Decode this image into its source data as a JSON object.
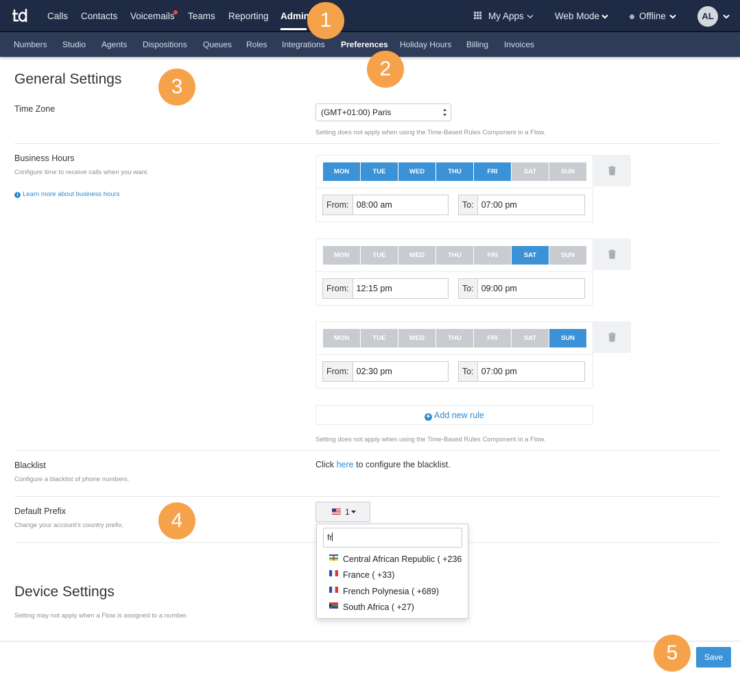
{
  "topnav": {
    "logo": "td",
    "items": [
      "Calls",
      "Contacts",
      "Voicemails",
      "Teams",
      "Reporting",
      "Admin"
    ],
    "my_apps": "My Apps",
    "web_mode": "Web Mode",
    "status": "Offline",
    "avatar": "AL"
  },
  "subnav": {
    "items": [
      "Numbers",
      "Studio",
      "Agents",
      "Dispositions",
      "Queues",
      "Roles",
      "Integrations",
      "Preferences",
      "Holiday Hours",
      "Billing",
      "Invoices"
    ]
  },
  "badges": [
    "1",
    "2",
    "3",
    "4",
    "5"
  ],
  "general": {
    "title": "General Settings",
    "timezone_label": "Time Zone",
    "timezone_value": "(GMT+01:00) Paris",
    "timezone_hint": "Setting does not apply when using the Time-Based Rules Component in a Flow.",
    "bh_label": "Business Hours",
    "bh_sub": "Configure time to receive calls when you want.",
    "bh_link": "Learn more about business hours",
    "days": [
      "MON",
      "TUE",
      "WED",
      "THU",
      "FRI",
      "SAT",
      "SUN"
    ],
    "from_label": "From:",
    "to_label": "To:",
    "rules": [
      {
        "from": "08:00 am",
        "to": "07:00 pm",
        "active": [
          true,
          true,
          true,
          true,
          true,
          false,
          false
        ]
      },
      {
        "from": "12:15 pm",
        "to": "09:00 pm",
        "active": [
          false,
          false,
          false,
          false,
          false,
          true,
          false
        ]
      },
      {
        "from": "02:30 pm",
        "to": "07:00 pm",
        "active": [
          false,
          false,
          false,
          false,
          false,
          false,
          true
        ]
      }
    ],
    "add_rule": "Add new rule",
    "bh_hint": "Setting does not apply when using the Time-Based Rules Component in a Flow.",
    "blacklist_label": "Blacklist",
    "blacklist_sub": "Configure a blacklist of phone numbers.",
    "blacklist_pre": "Click",
    "blacklist_link": "here",
    "blacklist_post": "to configure the blacklist.",
    "prefix_label": "Default Prefix",
    "prefix_sub": "Change your account's country prefix.",
    "prefix_value": "1",
    "search_value": "fr",
    "countries": [
      "Central African Republic ( +236",
      "France ( +33)",
      "French Polynesia ( +689)",
      "South Africa ( +27)"
    ]
  },
  "device": {
    "title": "Device Settings",
    "sub": "Setting may not apply when a Flow is assigned to a number."
  },
  "save_label": "Save",
  "colors": {
    "accent": "#3b92d6",
    "nav": "#1f2b44",
    "badge": "#f6a24a"
  }
}
